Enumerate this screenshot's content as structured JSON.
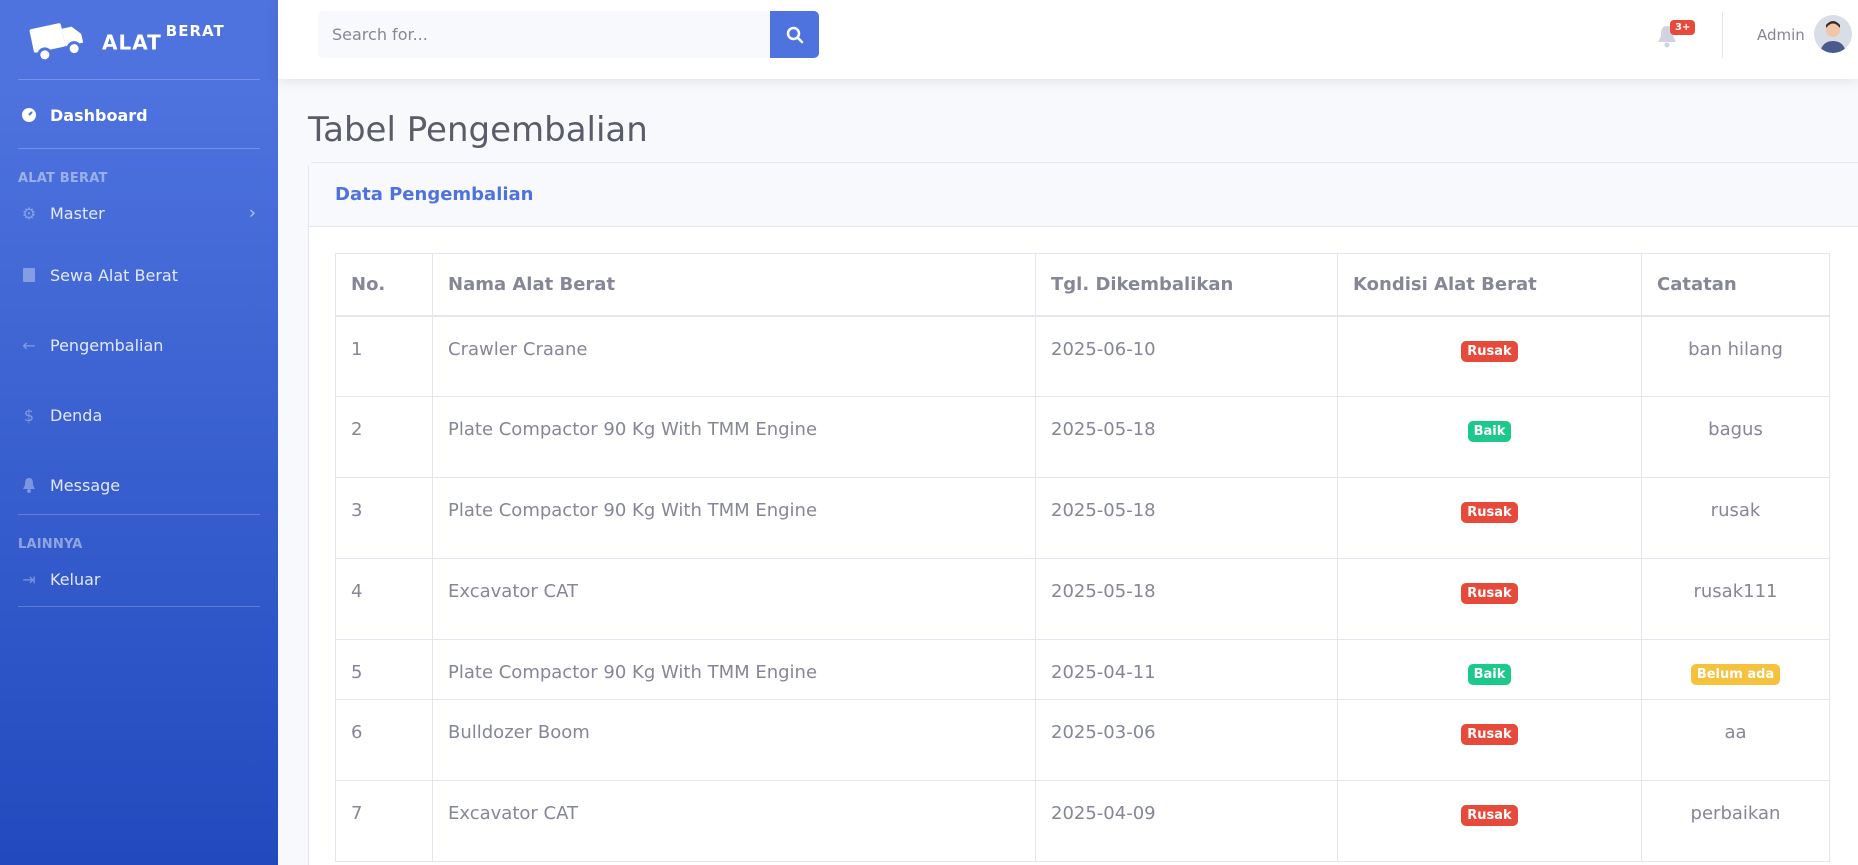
{
  "brand": {
    "name": "ALAT",
    "sup": "BERAT"
  },
  "sidebar": {
    "dashboard": "Dashboard",
    "heading_alat": "ALAT BERAT",
    "items": [
      {
        "label": "Master",
        "icon": "gear-icon"
      },
      {
        "label": "Sewa Alat Berat",
        "icon": "book-icon"
      },
      {
        "label": "Pengembalian",
        "icon": "arrow-left-icon"
      },
      {
        "label": "Denda",
        "icon": "dollar-icon"
      },
      {
        "label": "Message",
        "icon": "bell-icon"
      }
    ],
    "heading_lainnya": "LAINNYA",
    "logout": "Keluar"
  },
  "topbar": {
    "search_placeholder": "Search for...",
    "alerts_badge": "3+",
    "user": "Admin"
  },
  "page": {
    "title": "Tabel Pengembalian",
    "card_title": "Data Pengembalian"
  },
  "table": {
    "headers": [
      "No.",
      "Nama Alat Berat",
      "Tgl. Dikembalikan",
      "Kondisi Alat Berat",
      "Catatan"
    ],
    "rows": [
      {
        "no": "1",
        "nama": "Crawler Craane",
        "tgl": "2025-06-10",
        "kondisi": "Rusak",
        "catatan": "ban hilang"
      },
      {
        "no": "2",
        "nama": "Plate Compactor 90 Kg With TMM Engine",
        "tgl": "2025-05-18",
        "kondisi": "Baik",
        "catatan": "bagus"
      },
      {
        "no": "3",
        "nama": "Plate Compactor 90 Kg With TMM Engine",
        "tgl": "2025-05-18",
        "kondisi": "Rusak",
        "catatan": "rusak"
      },
      {
        "no": "4",
        "nama": "Excavator CAT",
        "tgl": "2025-05-18",
        "kondisi": "Rusak",
        "catatan": "rusak111"
      },
      {
        "no": "5",
        "nama": "Plate Compactor 90 Kg With TMM Engine",
        "tgl": "2025-04-11",
        "kondisi": "Baik",
        "catatan": "Belum ada"
      },
      {
        "no": "6",
        "nama": "Bulldozer Boom",
        "tgl": "2025-03-06",
        "kondisi": "Rusak",
        "catatan": "aa"
      },
      {
        "no": "7",
        "nama": "Excavator CAT",
        "tgl": "2025-04-09",
        "kondisi": "Rusak",
        "catatan": "perbaikan"
      }
    ]
  },
  "colors": {
    "primary": "#4e73df",
    "danger": "#e74a3b",
    "success": "#1cc88a",
    "warning": "#f6c23e"
  }
}
